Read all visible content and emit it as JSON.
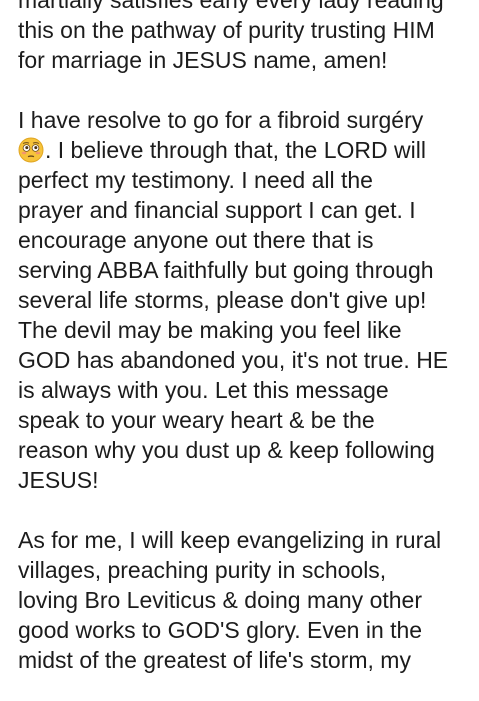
{
  "post": {
    "paragraph_1": [
      "martially satisfies early every lady reading",
      "this on the pathway of purity trusting HIM",
      "for marriage in JESUS name, amen!"
    ],
    "paragraph_2": {
      "first_line": "I have resolve to go for a fibroid surgéry",
      "emoji_icon": "flushed-face-icon",
      "emoji_line_rest": ". I believe through that, the LORD will",
      "lines": [
        "perfect my testimony. I need all the",
        "prayer and financial support I can get. I",
        "encourage anyone out there that is",
        "serving ABBA faithfully but going through",
        "several life storms, please don't give up!",
        "The devil may be making you feel like",
        "GOD has abandoned you, it's not true. HE",
        "is always with you. Let this message",
        "speak to your weary heart & be the",
        "reason why you dust up & keep following",
        "JESUS!"
      ]
    },
    "paragraph_3": [
      "As for me, I will keep evangelizing in rural",
      "villages, preaching purity in schools,",
      "loving Bro Leviticus & doing many other",
      "good works to GOD'S glory. Even in the",
      "midst of the greatest of life's storm, my"
    ]
  },
  "colors": {
    "text": "#1c1c1c",
    "background": "#ffffff",
    "emoji_face": "#f6c33a"
  }
}
